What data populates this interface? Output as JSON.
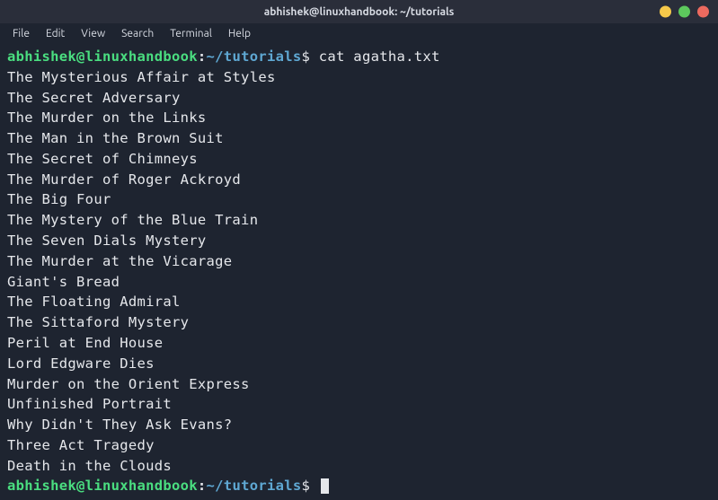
{
  "titlebar": {
    "title": "abhishek@linuxhandbook: ~/tutorials"
  },
  "window_controls": {
    "minimize": "minimize",
    "maximize": "maximize",
    "close": "close"
  },
  "menubar": {
    "items": [
      "File",
      "Edit",
      "View",
      "Search",
      "Terminal",
      "Help"
    ]
  },
  "prompt": {
    "user_host": "abhishek@linuxhandbook",
    "separator": ":",
    "path": "~/tutorials",
    "symbol": "$"
  },
  "command": "cat agatha.txt",
  "output_lines": [
    "The Mysterious Affair at Styles",
    "The Secret Adversary",
    "The Murder on the Links",
    "The Man in the Brown Suit",
    "The Secret of Chimneys",
    "The Murder of Roger Ackroyd",
    "The Big Four",
    "The Mystery of the Blue Train",
    "The Seven Dials Mystery",
    "The Murder at the Vicarage",
    "Giant's Bread",
    "The Floating Admiral",
    "The Sittaford Mystery",
    "Peril at End House",
    "Lord Edgware Dies",
    "Murder on the Orient Express",
    "Unfinished Portrait",
    "Why Didn't They Ask Evans?",
    "Three Act Tragedy",
    "Death in the Clouds"
  ]
}
